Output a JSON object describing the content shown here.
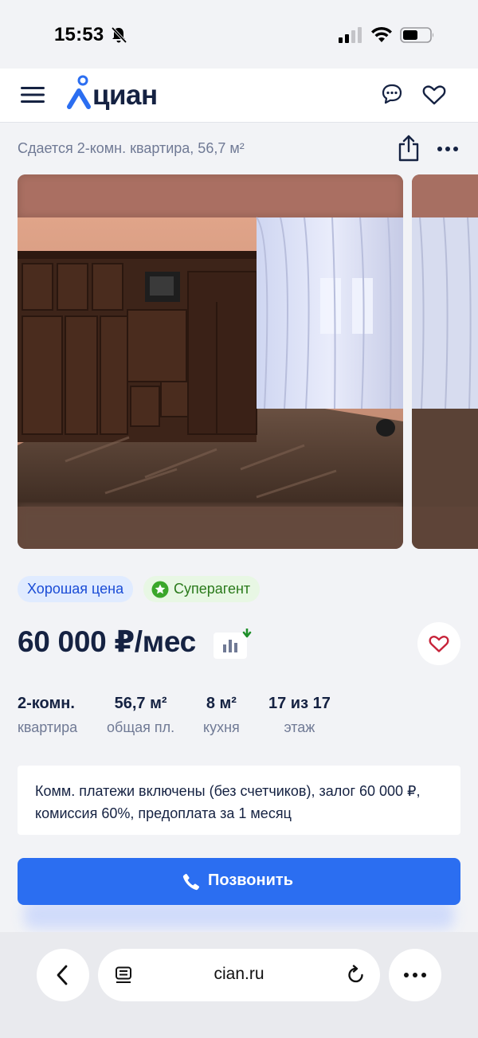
{
  "status_bar": {
    "time": "15:53"
  },
  "header": {
    "logo_text": "циан"
  },
  "listing": {
    "title": "Сдается 2-комн. квартира, 56,7 м²",
    "tags": {
      "good_price": "Хорошая цена",
      "superagent": "Суперагент"
    },
    "price": "60 000 ₽/мес",
    "params": [
      {
        "value": "2-комн.",
        "label": "квартира"
      },
      {
        "value": "56,7 м²",
        "label": "общая пл."
      },
      {
        "value": "8 м²",
        "label": "кухня"
      },
      {
        "value": "17 из 17",
        "label": "этаж"
      }
    ],
    "terms": "Комм. платежи включены (без счетчиков), залог 60 000 ₽, комиссия 60%, предоплата за 1 месяц"
  },
  "actions": {
    "call_label": "Позвонить"
  },
  "browser": {
    "url": "cian.ru"
  },
  "colors": {
    "brand_blue": "#2b6ef1",
    "text_primary": "#152242",
    "text_secondary": "#707a95",
    "good_price_bg": "#e0ebff",
    "superagent_bg": "#e8f7e4",
    "favorite_red": "#c7243a"
  },
  "icons": [
    "bell-slash-icon",
    "cellular-signal-icon",
    "wifi-icon",
    "battery-icon",
    "hamburger-menu-icon",
    "cian-logo-icon",
    "chat-icon",
    "heart-icon",
    "share-icon",
    "more-icon",
    "star-badge-icon",
    "price-chart-icon",
    "phone-icon",
    "chevron-left-icon",
    "reader-mode-icon",
    "reload-icon",
    "ellipsis-icon"
  ]
}
